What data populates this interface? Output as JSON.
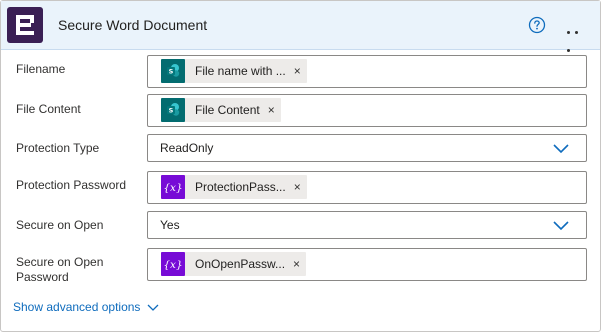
{
  "header": {
    "title": "Secure Word Document",
    "app_icon": "encodian-icon",
    "help_icon": "help-circle-icon",
    "more_icon": "more-ellipsis-icon",
    "accent_color": "#3a1f54",
    "header_bg": "#eaf3fb"
  },
  "fields": {
    "filename": {
      "label": "Filename",
      "token": "File name with ...",
      "token_icon": "sharepoint-icon",
      "close": "×"
    },
    "file_content": {
      "label": "File Content",
      "token": "File Content",
      "token_icon": "sharepoint-icon",
      "close": "×"
    },
    "protection_type": {
      "label": "Protection Type",
      "value": "ReadOnly"
    },
    "protection_password": {
      "label": "Protection Password",
      "token": "ProtectionPass...",
      "token_icon": "variable-icon",
      "close": "×"
    },
    "secure_on_open": {
      "label": "Secure on Open",
      "value": "Yes"
    },
    "secure_on_open_password": {
      "label_line1": "Secure on Open",
      "label_line2": "Password",
      "token": "OnOpenPassw...",
      "token_icon": "variable-icon",
      "close": "×"
    }
  },
  "footer": {
    "advanced_label": "Show advanced options"
  },
  "colors": {
    "sharepoint": "#036c70",
    "variable": "#770bd6",
    "link": "#0f6cbd",
    "chevron": "#0f6cbd"
  }
}
